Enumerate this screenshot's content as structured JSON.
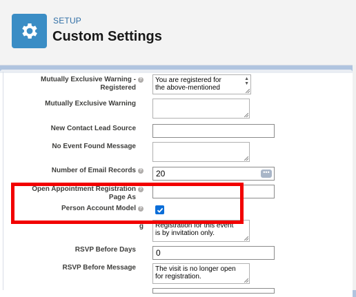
{
  "header": {
    "eyebrow": "SETUP",
    "title": "Custom Settings",
    "icon": "gear-icon",
    "icon_bg": "#3a8dc5"
  },
  "fields": {
    "mutually_exclusive_warning_registered": {
      "label_line1": "Mutually Exclusive Warning -",
      "label_line2": "Registered",
      "value_line1": "You are registered for",
      "value_line2": "the above-mentioned"
    },
    "mutually_exclusive_warning": {
      "label": "Mutually Exclusive Warning",
      "value": ""
    },
    "new_contact_lead_source": {
      "label": "New Contact Lead Source",
      "value": ""
    },
    "no_event_found_message": {
      "label": "No Event Found Message",
      "value": ""
    },
    "number_of_email_records": {
      "label": "Number of Email Records",
      "value": "20"
    },
    "open_appointment_registration_page_as": {
      "label_line1": "Open Appointment Registration",
      "label_line2": "Page As",
      "value": ""
    },
    "person_account_model": {
      "label": "Person Account Model",
      "checked": true
    },
    "partial_hidden_textarea": {
      "label_fragment": "g",
      "value_line1": "Registration for this event",
      "value_line2": "is by invitation only."
    },
    "rsvp_before_days": {
      "label": "RSVP Before Days",
      "value": "0"
    },
    "rsvp_before_message": {
      "label": "RSVP Before Message",
      "value_line1": "The visit is no longer open",
      "value_line2": "for registration."
    }
  },
  "colors": {
    "highlight": "#f20000",
    "checkbox": "#0b6ed8",
    "page_bg": "#b0c4df"
  }
}
